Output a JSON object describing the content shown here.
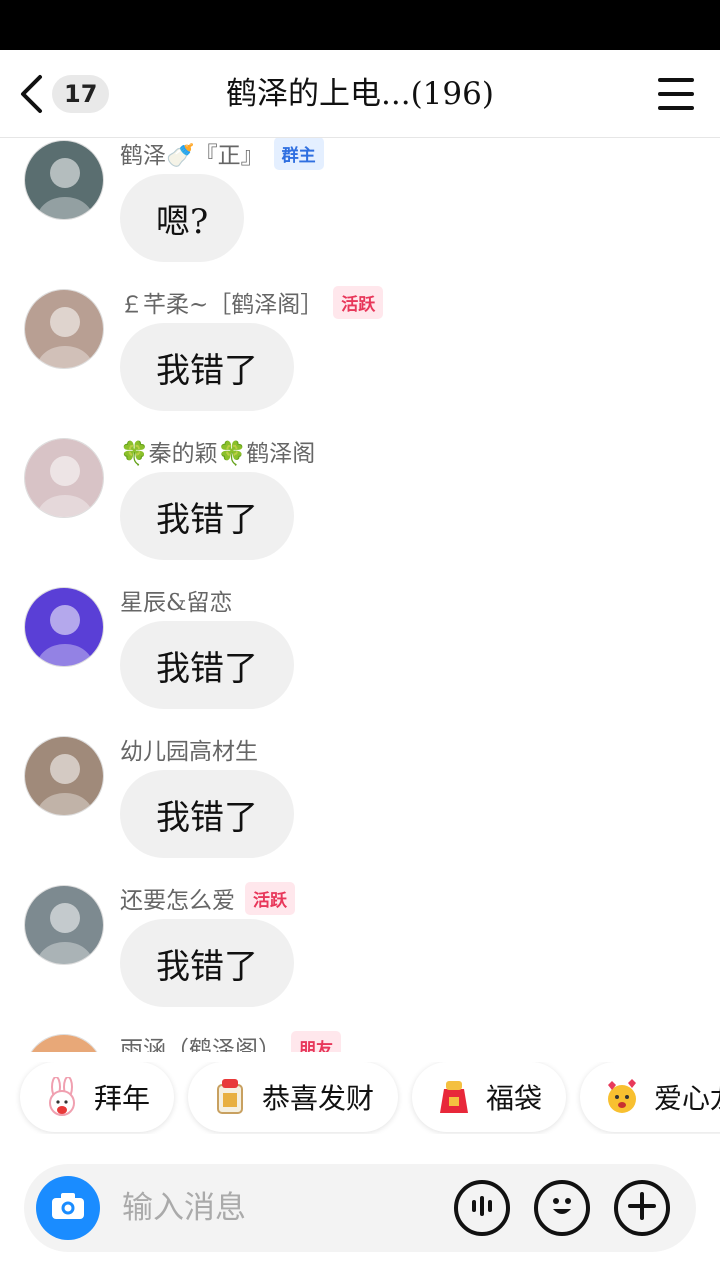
{
  "header": {
    "unread_count": "17",
    "title": "鹤泽的上电...(196)"
  },
  "messages": [
    {
      "sender": "鹤泽🍼『正』",
      "badge": "群主",
      "badge_type": "owner",
      "text": "嗯?",
      "avatar_color": "#5a6e70"
    },
    {
      "sender": "￡芊柔~［鹤泽阁］",
      "badge": "活跃",
      "badge_type": "active",
      "text": "我错了",
      "avatar_color": "#b89f93"
    },
    {
      "sender": "🍀秦的颖🍀鹤泽阁",
      "badge": "",
      "badge_type": "",
      "text": "我错了",
      "avatar_color": "#d8c3c6"
    },
    {
      "sender": "星辰&留恋",
      "badge": "",
      "badge_type": "",
      "text": "我错了",
      "avatar_color": "#5a3fd6"
    },
    {
      "sender": "幼儿园高材生",
      "badge": "",
      "badge_type": "",
      "text": "我错了",
      "avatar_color": "#a08a7a"
    },
    {
      "sender": "还要怎么爱",
      "badge": "活跃",
      "badge_type": "active",
      "text": "我错了",
      "avatar_color": "#7d8a90"
    },
    {
      "sender": "雨涵（鹤泽阁）",
      "badge": "朋友",
      "badge_type": "friend",
      "text": "",
      "avatar_color": "#e8a878"
    }
  ],
  "quick_replies": [
    {
      "label": "拜年",
      "icon": "rabbit-icon"
    },
    {
      "label": "恭喜发财",
      "icon": "fortune-icon"
    },
    {
      "label": "福袋",
      "icon": "lucky-bag-icon"
    },
    {
      "label": "爱心龙",
      "icon": "love-face-icon"
    }
  ],
  "composer": {
    "placeholder": "输入消息"
  },
  "colors": {
    "accent_blue": "#1a8cff",
    "owner_badge": "#2f6fe0",
    "active_badge": "#e8375a"
  }
}
